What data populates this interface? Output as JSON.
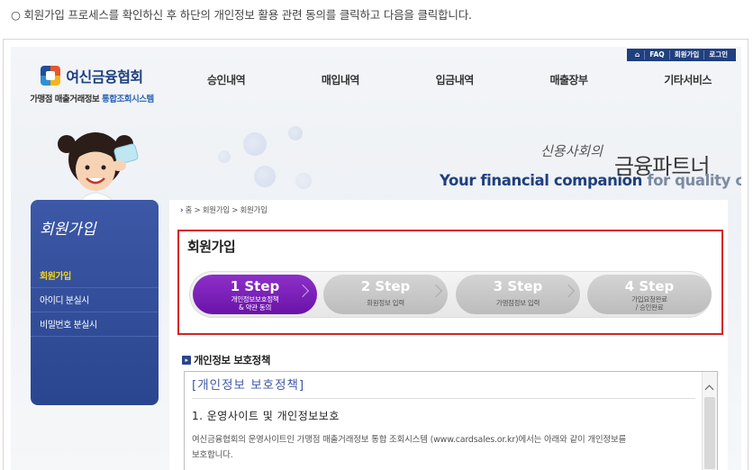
{
  "instruction": "○ 회원가입 프로세스를 확인하신 후 하단의 개인정보 활용 관련 동의를 클릭하고 다음을 클릭합니다.",
  "util_nav": [
    "⌂",
    "FAQ",
    "회원가입",
    "로그인"
  ],
  "logo": {
    "name": "여신금융협회",
    "sub_plain": "가맹점 매출거래정보 ",
    "sub_highlight": "통합조회시스템"
  },
  "gnb": [
    "승인내역",
    "매입내역",
    "입금내역",
    "매출장부",
    "기타서비스"
  ],
  "hero": {
    "slogan": "신용사회의",
    "title": "금융파트너",
    "en_main": "Your financial companion ",
    "en_tail": "for quality credit"
  },
  "lnb": {
    "title": "회원가입",
    "items": [
      "회원가입",
      "아이디 분실시",
      "비밀번호 분실시"
    ]
  },
  "breadcrumb": {
    "home": "홈",
    "level1": "회원가입",
    "level2": "회원가입"
  },
  "page_title": "회원가입",
  "steps": [
    {
      "num": "1 Step",
      "label_1": "개인정보보호정책",
      "label_2": "& 약관 동의"
    },
    {
      "num": "2 Step",
      "label_1": "회원정보 입력",
      "label_2": ""
    },
    {
      "num": "3 Step",
      "label_1": "가맹점정보 입력",
      "label_2": ""
    },
    {
      "num": "4 Step",
      "label_1": "가입요청완료",
      "label_2": "/ 승인완료"
    }
  ],
  "section_title": "개인정보 보호정책",
  "policy": {
    "heading": "[개인정보 보호정책]",
    "sub": "1. 운영사이트 및 개인정보보호",
    "text_1": "여신금융협회의 운영사이트인 가맹점 매출거래정보 통합 조회시스템 (www.cardsales.or.kr)에서는 아래와 같이 개인정보를",
    "text_2": "보호합니다."
  },
  "colors": {
    "brand": "#1f3f7f",
    "step_active": "#6a13a8",
    "highlight_border": "#d42227",
    "menu_active": "#f3d21b"
  }
}
